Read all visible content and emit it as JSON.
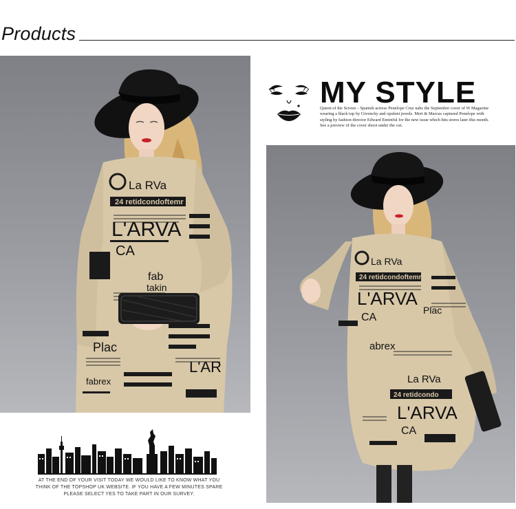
{
  "header": {
    "title": "Products"
  },
  "my_style": {
    "title": "MY STYLE",
    "caption": "Queen of the Screen – Spanish actress Penelope Cruz nabs the September cover of W Magazine wearing a black top by Givenchy and opulent jewels. Mert & Marcus captured Penelope with styling by fashion director Edward Enninful for the new issue which hits stores later this month. See a preview of the cover shoot under the cut."
  },
  "skyline": {
    "caption": "AT THE END OF YOUR VISIT TODAY WE WOULD LIKE TO KNOW WHAT YOU THINK OF THE TOPSHOP UK WEBSITE. IF YOU HAVE A FEW MINUTES SPARE PLEASE SELECT YES TO TAKE PART IN OUR SURVEY."
  },
  "photos": {
    "left_print": {
      "brand": "La RVa",
      "banner": "24 retidcondoftemr",
      "headline": "L'ARVA",
      "sub": "CA",
      "fab": "fab",
      "takin": "takin",
      "plac": "Plac",
      "fabrex": "fabrex"
    },
    "right_print": {
      "brand": "La RVa",
      "banner": "24 retidcondoftemr",
      "headline": "L'ARVA",
      "sub": "CA",
      "plac": "Plac",
      "fabrex": "abrex",
      "brand2": "La RVa",
      "banner2": "24 retidcondo",
      "headline2": "L'ARVA",
      "sub2": "CA"
    }
  },
  "icons": {
    "face": "marilyn-face-icon",
    "skyline": "city-skyline-icon",
    "clutch": "clutch-bag-icon"
  },
  "colors": {
    "background": "#ffffff",
    "studio_gray": "#8c8e94",
    "dress_beige": "#d8c8a8",
    "ink": "#111111",
    "lips": "#c8202a"
  }
}
